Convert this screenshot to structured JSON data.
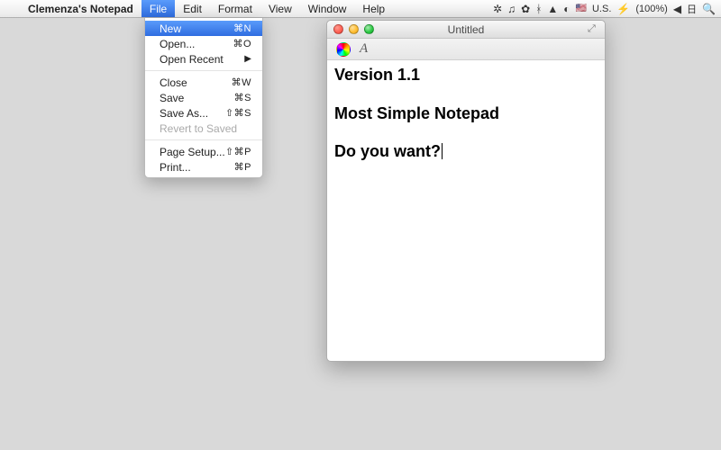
{
  "menubar": {
    "app_name": "Clemenza's Notepad",
    "menus": [
      "File",
      "Edit",
      "Format",
      "View",
      "Window",
      "Help"
    ],
    "open_menu_index": 0,
    "status": {
      "flag": "U.S.",
      "battery_label": "(100%)",
      "ime": "日"
    }
  },
  "file_menu": {
    "items": [
      {
        "label": "New",
        "shortcut": "⌘N",
        "highlighted": true
      },
      {
        "label": "Open...",
        "shortcut": "⌘O"
      },
      {
        "label": "Open Recent",
        "submenu": true
      },
      {
        "sep": true
      },
      {
        "label": "Close",
        "shortcut": "⌘W"
      },
      {
        "label": "Save",
        "shortcut": "⌘S"
      },
      {
        "label": "Save As...",
        "shortcut": "⇧⌘S"
      },
      {
        "label": "Revert to Saved",
        "disabled": true
      },
      {
        "sep": true
      },
      {
        "label": "Page Setup...",
        "shortcut": "⇧⌘P"
      },
      {
        "label": "Print...",
        "shortcut": "⌘P"
      }
    ]
  },
  "window": {
    "title": "Untitled",
    "content": {
      "line1": "Version 1.1",
      "line2": "Most Simple Notepad",
      "line3": "Do you want?"
    }
  }
}
